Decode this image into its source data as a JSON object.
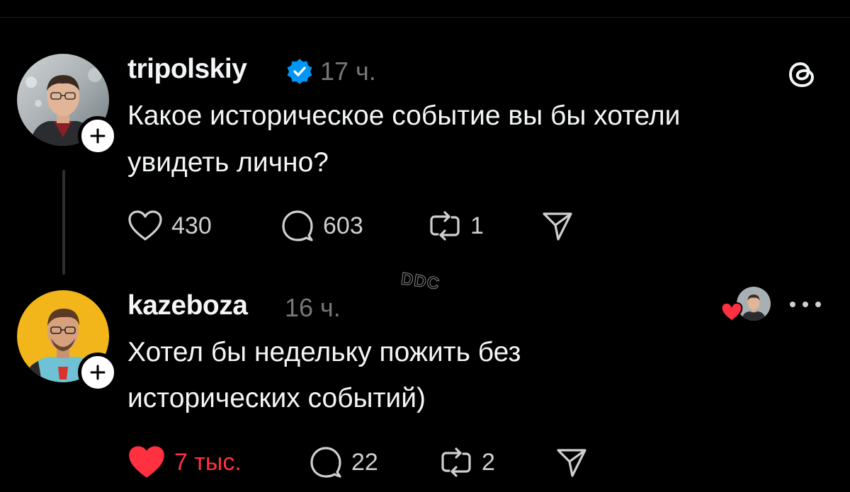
{
  "posts": [
    {
      "username": "tripolskiy",
      "verified": true,
      "time": "17 ч.",
      "text_lines": [
        "Какое историческое событие вы бы хотели",
        "увидеть лично?"
      ],
      "likes": "430",
      "liked": false,
      "replies": "603",
      "reposts": "1"
    },
    {
      "username": "kazeboza",
      "verified": false,
      "time": "16 ч.",
      "text_lines": [
        "Хотел бы недельку пожить без",
        "исторических событий)"
      ],
      "likes": "7 тыс.",
      "liked": true,
      "replies": "22",
      "reposts": "2"
    }
  ],
  "watermark": "DDC",
  "colors": {
    "background": "#000000",
    "text": "#f3f5f7",
    "muted": "#777777",
    "like_red": "#ff3040",
    "verified_blue": "#0095f6"
  },
  "icons": [
    "threads-logo-icon",
    "verified-badge-icon",
    "heart-icon",
    "comment-icon",
    "repost-icon",
    "share-icon",
    "more-icon",
    "plus-icon"
  ]
}
